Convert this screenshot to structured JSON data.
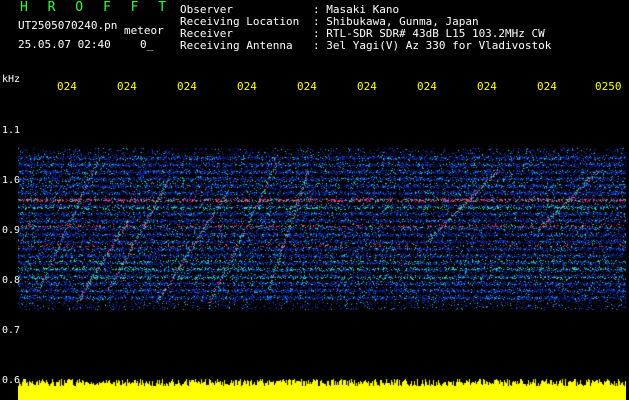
{
  "header": {
    "brand": "H R O F F T",
    "file_name": "UT2505070240.pn",
    "mode": "meteor",
    "datetime": "25.05.07 02:40",
    "mark": "0_",
    "labels": {
      "observer": "Observer",
      "location": "Receiving Location",
      "receiver": "Receiver",
      "antenna": "Receiving Antenna"
    },
    "values": {
      "observer": ": Masaki Kano",
      "location": ": Shibukawa, Gunma, Japan",
      "receiver": ": RTL-SDR SDR# 43dB L15 103.2MHz CW",
      "antenna": ": 3el Yagi(V) Az 330 for Vladivostok"
    }
  },
  "axis": {
    "unit": "kHz",
    "y_ticks": [
      "1.1",
      "1.0",
      "0.9",
      "0.8",
      "0.7",
      "0.6"
    ],
    "x_ticks": [
      "024",
      "024",
      "024",
      "024",
      "024",
      "024",
      "024",
      "024",
      "024",
      "0250"
    ]
  },
  "colors": {
    "brand": "#33ff33",
    "text": "#ffffff",
    "time_label": "#ffff00",
    "background": "#000000",
    "signal_low": "#1030c0",
    "signal_mid": "#20d0a0",
    "signal_high": "#ff3070",
    "strip": "#ffff00"
  }
}
